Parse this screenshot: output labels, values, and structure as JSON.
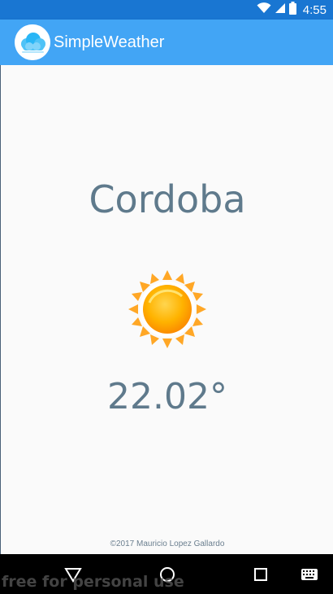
{
  "status_bar": {
    "time": "4:55",
    "icons": [
      "wifi-icon",
      "signal-icon",
      "battery-icon"
    ]
  },
  "app_bar": {
    "title": "SimpleWeather",
    "logo_icon": "cloud-logo-icon"
  },
  "weather": {
    "city": "Cordoba",
    "temperature": "22.02°",
    "condition_icon": "sun-icon"
  },
  "footer": {
    "credit": "©2017 Mauricio Lopez Gallardo"
  },
  "nav_bar": {
    "buttons": [
      "back-icon",
      "home-icon",
      "recents-icon",
      "keyboard-icon"
    ]
  },
  "watermark": {
    "text": "free for personal use"
  },
  "colors": {
    "status_bar": "#1976d2",
    "app_bar": "#42a5f5",
    "text_primary": "#5f7a8c",
    "sun": "#ffa000"
  }
}
